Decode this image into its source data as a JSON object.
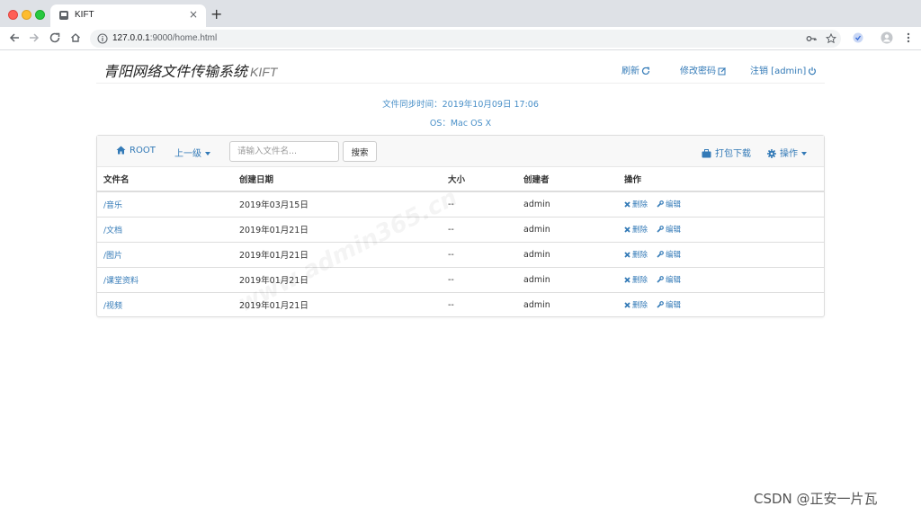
{
  "browser": {
    "tab_title": "KIFT",
    "tab_close": "×",
    "new_tab": "+",
    "url_host": "127.0.0.1",
    "url_rest": ":9000/home.html"
  },
  "header": {
    "brand": "青阳网络文件传输系统",
    "brand_suffix": "KIFT",
    "refresh": "刷新",
    "change_password": "修改密码",
    "logout": "注销 [admin]"
  },
  "info": {
    "sync_time": "文件同步时间：2019年10月09日 17:06",
    "os": "OS：Mac OS X"
  },
  "toolbar": {
    "root": "ROOT",
    "parent": "上一级",
    "search_placeholder": "请输入文件名...",
    "search_button": "搜索",
    "pack_download": "打包下载",
    "operations": "操作"
  },
  "table": {
    "headers": [
      "文件名",
      "创建日期",
      "大小",
      "创建者",
      "操作"
    ],
    "rows": [
      {
        "name": "/音乐",
        "date": "2019年03月15日",
        "size": "--",
        "creator": "admin"
      },
      {
        "name": "/文档",
        "date": "2019年01月21日",
        "size": "--",
        "creator": "admin"
      },
      {
        "name": "/图片",
        "date": "2019年01月21日",
        "size": "--",
        "creator": "admin"
      },
      {
        "name": "/课堂资料",
        "date": "2019年01月21日",
        "size": "--",
        "creator": "admin"
      },
      {
        "name": "/视频",
        "date": "2019年01月21日",
        "size": "--",
        "creator": "admin"
      }
    ],
    "delete_label": "删除",
    "edit_label": "编辑"
  },
  "watermark": "www.admin365.cn",
  "credit": "CSDN @正安一片瓦",
  "colors": {
    "link": "#337ab7",
    "info": "#4a90c8"
  }
}
